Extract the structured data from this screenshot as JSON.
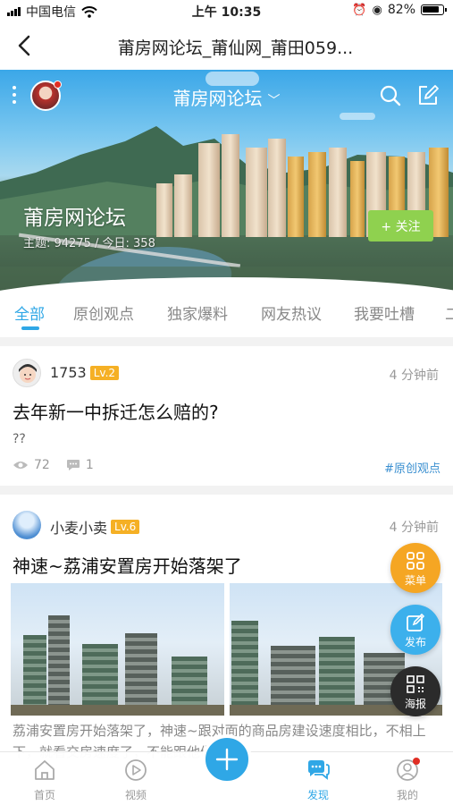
{
  "status_bar": {
    "carrier": "中国电信",
    "time": "上午 10:35",
    "battery": "82%"
  },
  "nav": {
    "title": "莆房网论坛_莆仙网_莆田059..."
  },
  "hero": {
    "title": "莆房网论坛",
    "forum_name": "莆房网论坛",
    "stats": "主题: 94275 / 今日: 358",
    "follow_label": "+ 关注"
  },
  "tabs": [
    {
      "label": "全部",
      "active": true
    },
    {
      "label": "原创观点",
      "active": false
    },
    {
      "label": "独家爆料",
      "active": false
    },
    {
      "label": "网友热议",
      "active": false
    },
    {
      "label": "我要吐槽",
      "active": false
    },
    {
      "label": "二",
      "active": false
    }
  ],
  "posts": [
    {
      "username": "1753",
      "level": "Lv.2",
      "time": "4 分钟前",
      "title": "去年新一中拆迁怎么赔的?",
      "body": "??",
      "views": "72",
      "comments": "1",
      "tag": "#原创观点"
    },
    {
      "username": "小麦小卖",
      "level": "Lv.6",
      "time": "4 分钟前",
      "title": "神速~荔浦安置房开始落架了",
      "body": "荔浦安置房开始落架了，神速~跟对面的商品房建设速度相比，不相上下，就看交房速度了，不能跟他们一样..."
    }
  ],
  "fabs": {
    "menu": "菜单",
    "publish": "发布",
    "poster": "海报"
  },
  "tabbar": [
    {
      "label": "首页",
      "icon": "home-icon",
      "active": false
    },
    {
      "label": "视频",
      "icon": "play-icon",
      "active": false
    },
    {
      "label": "发现",
      "icon": "chat-icon",
      "active": true
    },
    {
      "label": "我的",
      "icon": "user-icon",
      "active": false
    }
  ],
  "colors": {
    "accent": "#2fa7e6",
    "follow_green": "#8fd14f",
    "level_orange": "#f5b025",
    "menu_orange": "#f5a623",
    "publish_blue": "#3cb0ec",
    "poster_dark": "#2b2b2b"
  }
}
